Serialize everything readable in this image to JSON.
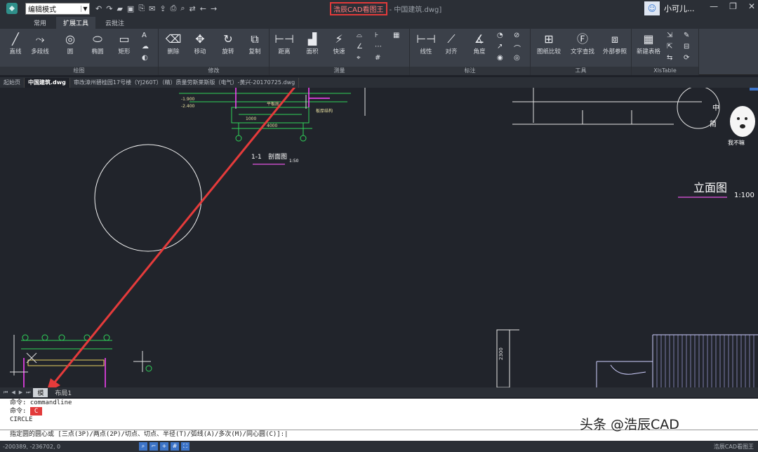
{
  "titlebar": {
    "mode_select": "编辑模式",
    "app_name": "浩辰CAD看图王",
    "doc_name": "- 中国建筑.dwg]",
    "user_name": "小可儿..."
  },
  "ribbon_tabs": [
    "常用",
    "扩展工具",
    "云批注"
  ],
  "ribbon_groups": {
    "draw": {
      "label": "绘图",
      "tools": [
        "直线",
        "多段线",
        "圆",
        "椭圆",
        "矩形"
      ]
    },
    "modify": {
      "label": "修改",
      "tools": [
        "删除",
        "移动",
        "旋转",
        "复制"
      ]
    },
    "measure": {
      "label": "测量",
      "tools": [
        "距离",
        "面积",
        "快速"
      ]
    },
    "annotate": {
      "label": "标注",
      "tools": [
        "线性",
        "对齐",
        "角度"
      ]
    },
    "utility": {
      "label": "工具",
      "tools": [
        "图纸比较",
        "文字查找",
        "外部参照"
      ]
    },
    "xls": {
      "label": "XlsTable",
      "tools": [
        "新建表格"
      ]
    }
  },
  "doc_tabs": [
    "起始页",
    "中国建筑.dwg",
    "审改漳州碧桂园17号楼（YJ260T）（精）质量劳斯莱斯版（电气）-黄兴-20170725.dwg"
  ],
  "drawing": {
    "section_label": "1-1",
    "section_title": "剖面图",
    "section_scale": "1:50",
    "elevation_title": "立面图",
    "elevation_scale": "1:100",
    "sticker_text": "我不嘛",
    "side_text1": "中",
    "side_text2": "简",
    "dim_2300": "2300"
  },
  "layout_tabs": [
    "模",
    "布局1"
  ],
  "command": {
    "line1": "命令: commandline",
    "line2_prefix": "命令:",
    "line2_cmd": "C",
    "line3": "CIRCLE",
    "prompt": "指定圆的圆心或 [三点(3P)/两点(2P)/切点、切点、半径(T)/弧线(A)/多次(M)/同心圆(C)]:"
  },
  "status": {
    "coords": "-200389, -236702, 0",
    "app": "浩辰CAD看图王"
  },
  "watermark": "头条 @浩辰CAD",
  "colors": {
    "accent_red": "#e23a3a",
    "canvas_bg": "#21242b"
  }
}
